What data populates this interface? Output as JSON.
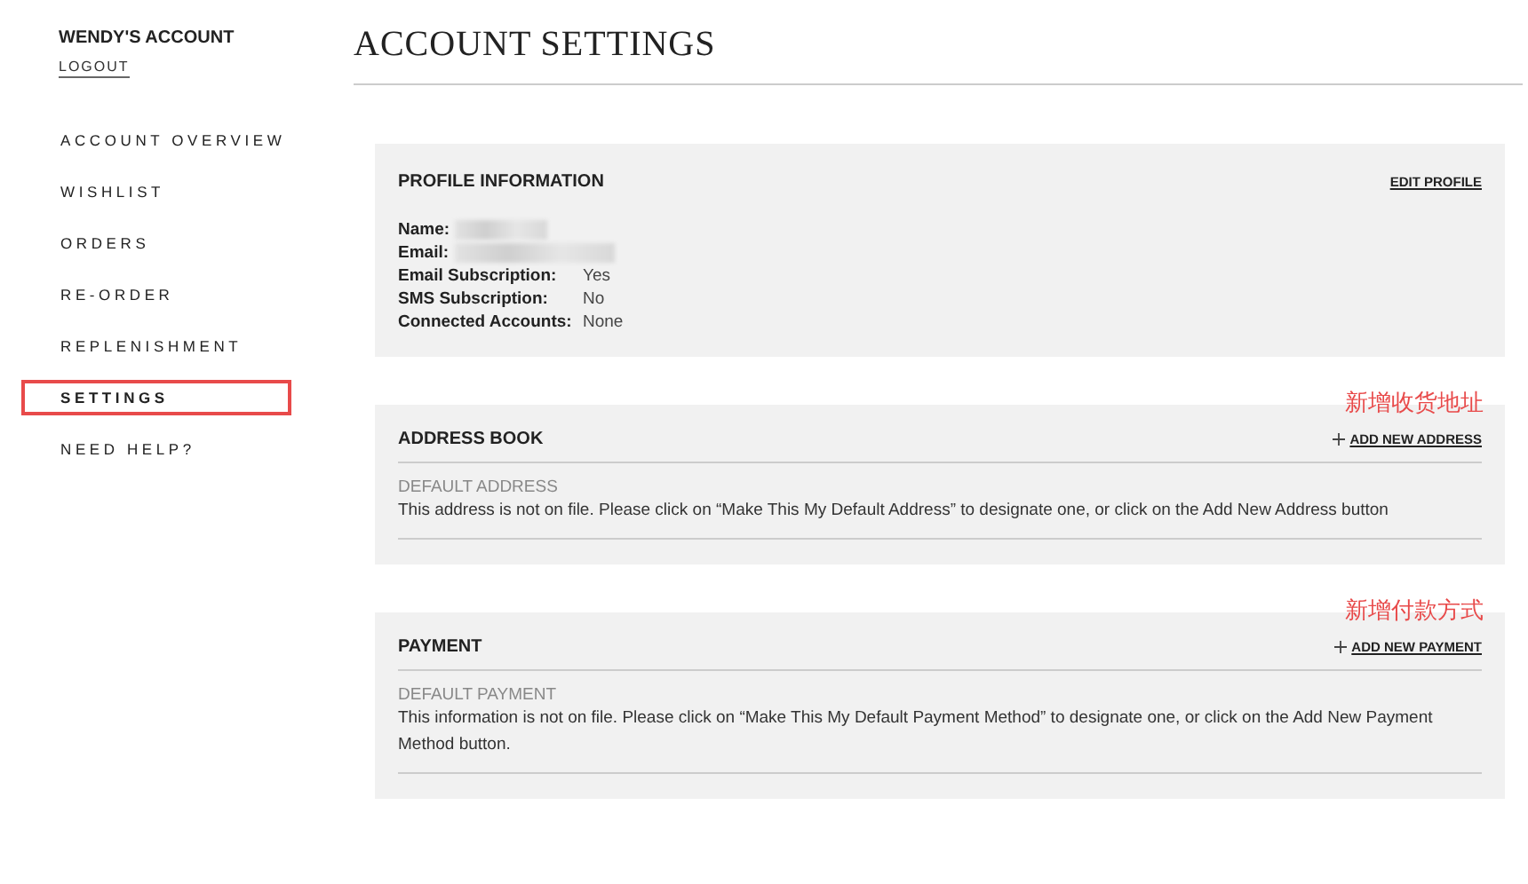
{
  "sidebar": {
    "account_name": "WENDY'S ACCOUNT",
    "logout": "LOGOUT",
    "items": [
      {
        "label": "ACCOUNT OVERVIEW",
        "selected": false,
        "highlighted": false
      },
      {
        "label": "WISHLIST",
        "selected": false,
        "highlighted": false
      },
      {
        "label": "ORDERS",
        "selected": false,
        "highlighted": false
      },
      {
        "label": "RE-ORDER",
        "selected": false,
        "highlighted": false
      },
      {
        "label": "REPLENISHMENT",
        "selected": false,
        "highlighted": false
      },
      {
        "label": "SETTINGS",
        "selected": true,
        "highlighted": true
      },
      {
        "label": "NEED HELP?",
        "selected": false,
        "highlighted": false
      }
    ]
  },
  "page_title": "ACCOUNT SETTINGS",
  "profile": {
    "title": "PROFILE INFORMATION",
    "action": "EDIT PROFILE",
    "fields": [
      {
        "label": "Name:"
      },
      {
        "label": "Email:"
      },
      {
        "label": "Email Subscription:",
        "value": "Yes"
      },
      {
        "label": "SMS Subscription:",
        "value": "No"
      },
      {
        "label": "Connected Accounts:",
        "value": "None"
      }
    ]
  },
  "sections": [
    {
      "title": "ADDRESS BOOK",
      "action": "ADD NEW ADDRESS",
      "annotation": "新增收货地址",
      "subtitle": "DEFAULT ADDRESS",
      "text": "This address is not on file. Please click on “Make This My Default Address” to designate one, or click on the Add New Address button"
    },
    {
      "title": "PAYMENT",
      "action": "ADD NEW PAYMENT",
      "annotation": "新增付款方式",
      "subtitle": "DEFAULT PAYMENT",
      "text": "This information is not on file. Please click on “Make This My Default Payment Method” to designate one, or click on the Add New Payment Method button."
    }
  ]
}
